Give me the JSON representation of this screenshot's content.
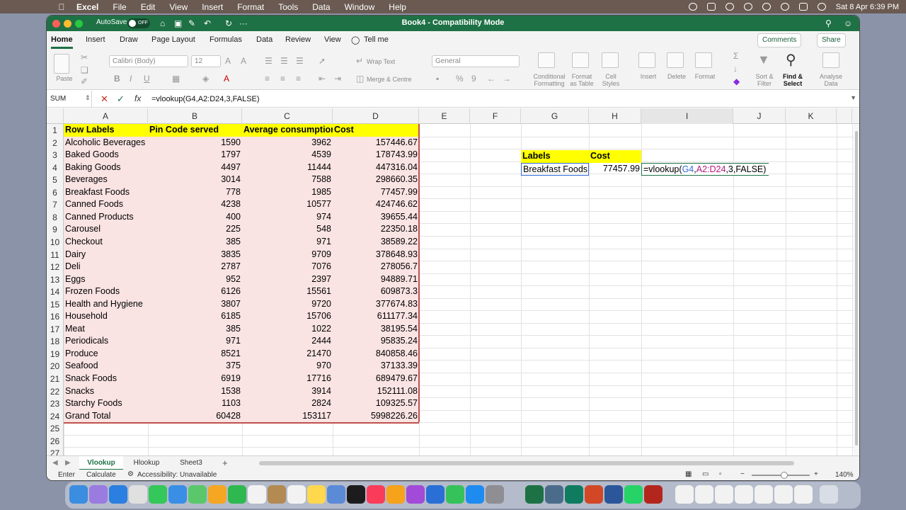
{
  "menubar": {
    "app": "Excel",
    "items": [
      "File",
      "Edit",
      "View",
      "Insert",
      "Format",
      "Tools",
      "Data",
      "Window",
      "Help"
    ],
    "datetime": "Sat 8 Apr  6:39 PM"
  },
  "titlebar": {
    "autosave_label": "AutoSave",
    "autosave_state": "OFF",
    "title": "Book4  -  Compatibility Mode"
  },
  "ribbon_tabs": [
    "Home",
    "Insert",
    "Draw",
    "Page Layout",
    "Formulas",
    "Data",
    "Review",
    "View",
    "Tell me"
  ],
  "ribbon_buttons": {
    "comments": "Comments",
    "share": "Share"
  },
  "ribbon": {
    "paste": "Paste",
    "font_name": "Calibri (Body)",
    "font_size": "12",
    "bold": "B",
    "italic": "I",
    "underline": "U",
    "wrap_text": "Wrap Text",
    "merge_centre": "Merge & Centre",
    "number_format": "General",
    "conditional_formatting": "Conditional Formatting",
    "format_as_table": "Format as Table",
    "cell_styles": "Cell Styles",
    "insert": "Insert",
    "delete": "Delete",
    "format": "Format",
    "sort_filter": "Sort & Filter",
    "find_select": "Find & Select",
    "analyse_data": "Analyse Data"
  },
  "formula_bar": {
    "name_box": "SUM",
    "fx": "fx",
    "formula": "=vlookup(G4,A2:D24,3,FALSE)"
  },
  "columns": [
    "A",
    "B",
    "C",
    "D",
    "E",
    "F",
    "G",
    "H",
    "I",
    "J",
    "K"
  ],
  "table_headers": [
    "Row Labels",
    "Pin Code served",
    "Average consumption",
    "Cost"
  ],
  "table_rows": [
    [
      "Alcoholic Beverages",
      "1590",
      "3962",
      "157446.67"
    ],
    [
      "Baked Goods",
      "1797",
      "4539",
      "178743.99"
    ],
    [
      "Baking Goods",
      "4497",
      "11444",
      "447316.04"
    ],
    [
      "Beverages",
      "3014",
      "7588",
      "298660.35"
    ],
    [
      "Breakfast Foods",
      "778",
      "1985",
      "77457.99"
    ],
    [
      "Canned Foods",
      "4238",
      "10577",
      "424746.62"
    ],
    [
      "Canned Products",
      "400",
      "974",
      "39655.44"
    ],
    [
      "Carousel",
      "225",
      "548",
      "22350.18"
    ],
    [
      "Checkout",
      "385",
      "971",
      "38589.22"
    ],
    [
      "Dairy",
      "3835",
      "9709",
      "378648.93"
    ],
    [
      "Deli",
      "2787",
      "7076",
      "278056.7"
    ],
    [
      "Eggs",
      "952",
      "2397",
      "94889.71"
    ],
    [
      "Frozen Foods",
      "6126",
      "15561",
      "609873.3"
    ],
    [
      "Health and Hygiene",
      "3807",
      "9720",
      "377674.83"
    ],
    [
      "Household",
      "6185",
      "15706",
      "611177.34"
    ],
    [
      "Meat",
      "385",
      "1022",
      "38195.54"
    ],
    [
      "Periodicals",
      "971",
      "2444",
      "95835.24"
    ],
    [
      "Produce",
      "8521",
      "21470",
      "840858.46"
    ],
    [
      "Seafood",
      "375",
      "970",
      "37133.39"
    ],
    [
      "Snack Foods",
      "6919",
      "17716",
      "689479.67"
    ],
    [
      "Snacks",
      "1538",
      "3914",
      "152111.08"
    ],
    [
      "Starchy Foods",
      "1103",
      "2824",
      "109325.57"
    ],
    [
      "Grand Total",
      "60428",
      "153117",
      "5998226.26"
    ]
  ],
  "lookup": {
    "label_header": "Labels",
    "cost_header": "Cost",
    "label_value": "Breakfast Foods",
    "cost_value": "77457.99",
    "formula_prefix": "=vlookup(",
    "formula_ref1": "G4",
    "formula_comma": ",",
    "formula_ref2": "A2:D24",
    "formula_suffix": ",3,FALSE)"
  },
  "sheets": [
    "Vlookup",
    "Hlookup",
    "Sheet3"
  ],
  "statusbar": {
    "mode": "Enter",
    "calc": "Calculate",
    "accessibility": "Accessibility: Unavailable",
    "zoom": "140%"
  },
  "colors": {
    "excel_green": "#1e7145",
    "header_yellow": "#ffff00",
    "table_pink": "#fae3e3"
  }
}
